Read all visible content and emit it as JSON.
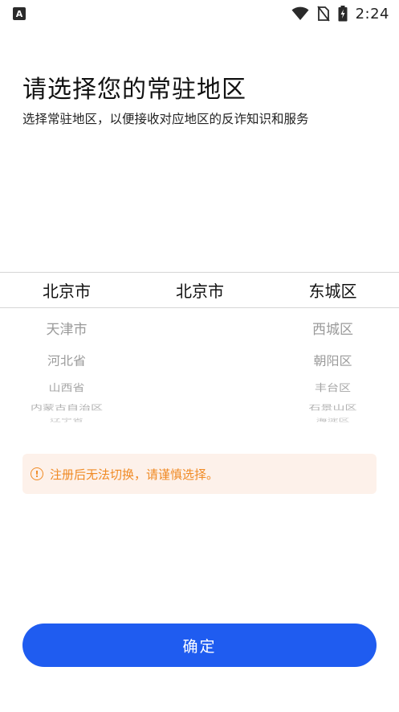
{
  "status_bar": {
    "app_icon_letter": "A",
    "time": "2:24",
    "icons": [
      "wifi-icon",
      "no-sim-icon",
      "battery-charging-icon"
    ]
  },
  "header": {
    "title": "请选择您的常驻地区",
    "subtitle": "选择常驻地区，以便接收对应地区的反诈知识和服务"
  },
  "picker": {
    "province": {
      "selected": "北京市",
      "below": [
        "天津市",
        "河北省",
        "山西省",
        "内蒙古自治区",
        "辽宁省"
      ]
    },
    "city": {
      "selected": "北京市",
      "below": []
    },
    "district": {
      "selected": "东城区",
      "below": [
        "西城区",
        "朝阳区",
        "丰台区",
        "石景山区",
        "海淀区"
      ]
    }
  },
  "notice": {
    "icon": "info-icon",
    "text": "注册后无法切换，请谨慎选择。",
    "color": "#f08a24",
    "background": "#fdf1ea"
  },
  "confirm_button": {
    "label": "确定",
    "color": "#1f5cf0"
  }
}
